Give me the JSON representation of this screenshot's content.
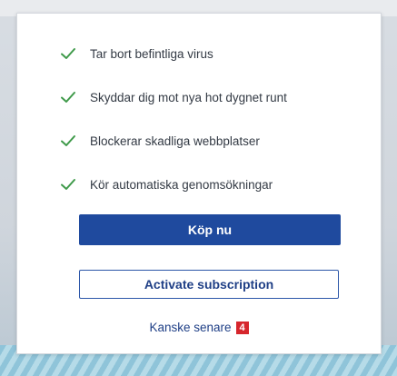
{
  "features": [
    {
      "label": "Tar bort befintliga virus",
      "icon": "check-icon"
    },
    {
      "label": "Skyddar dig mot nya hot dygnet runt",
      "icon": "check-icon"
    },
    {
      "label": "Blockerar skadliga webbplatser",
      "icon": "check-icon"
    },
    {
      "label": "Kör automatiska genomsökningar",
      "icon": "check-icon"
    }
  ],
  "buttons": {
    "buy_label": "Köp nu",
    "activate_label": "Activate subscription"
  },
  "later": {
    "label": "Kanske senare",
    "badge": "4"
  },
  "colors": {
    "check": "#3f9a4a",
    "primary": "#1f4a9e",
    "badge": "#d6262c"
  }
}
